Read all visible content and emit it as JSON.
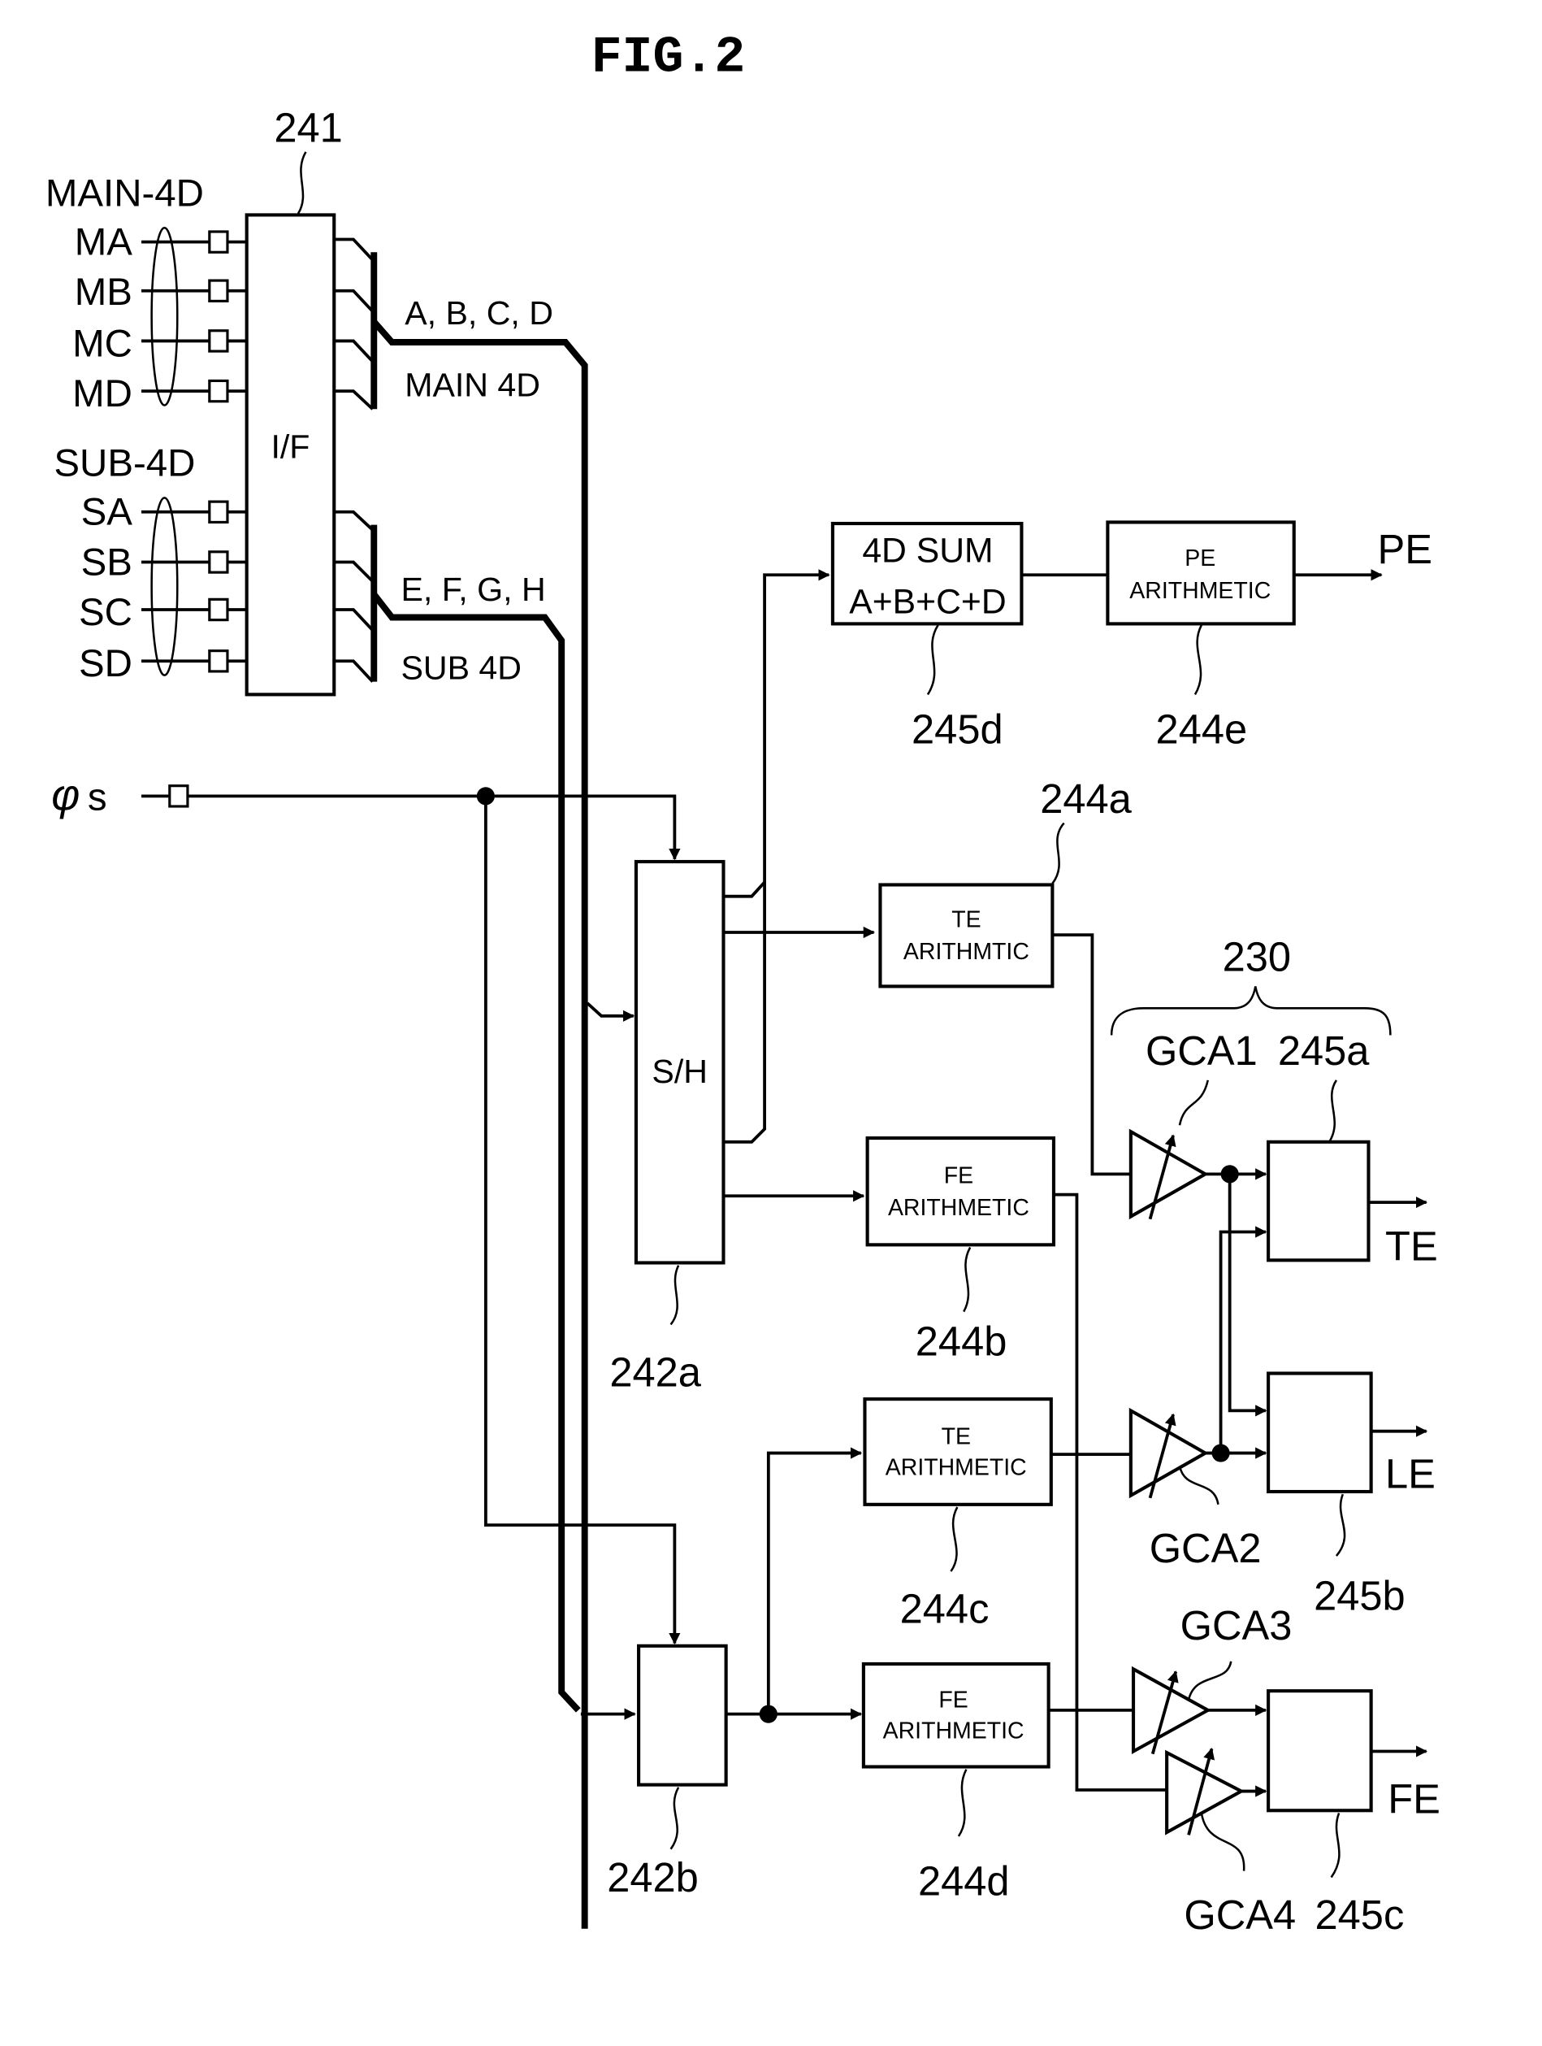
{
  "figure": {
    "title": "FIG.2"
  },
  "interface": {
    "ref": "241",
    "label": "I/F",
    "main_group_label": "MAIN-4D",
    "sub_group_label": "SUB-4D",
    "main_inputs": [
      "MA",
      "MB",
      "MC",
      "MD"
    ],
    "sub_inputs": [
      "SA",
      "SB",
      "SC",
      "SD"
    ],
    "main_bus_signals": "A, B, C, D",
    "main_bus_label": "MAIN 4D",
    "sub_bus_signals": "E, F, G, H",
    "sub_bus_label": "SUB 4D"
  },
  "clock": {
    "label_symbol": "φ",
    "label_sub": "s"
  },
  "sample_hold": {
    "main": {
      "ref": "242a",
      "label": "S/H"
    },
    "sub": {
      "ref": "242b",
      "label": ""
    }
  },
  "sum_block": {
    "ref": "245d",
    "line1": "4D  SUM",
    "line2": "A+B+C+D"
  },
  "pe_block": {
    "ref": "244e",
    "line1": "PE",
    "line2": "ARITHMETIC",
    "output": "PE"
  },
  "arith_blocks": [
    {
      "ref": "244a",
      "line1": "TE",
      "line2": "ARITHMTIC"
    },
    {
      "ref": "244b",
      "line1": "FE",
      "line2": "ARITHMETIC"
    },
    {
      "ref": "244c",
      "line1": "TE",
      "line2": "ARITHMETIC"
    },
    {
      "ref": "244d",
      "line1": "FE",
      "line2": "ARITHMETIC"
    }
  ],
  "gain_group": {
    "ref": "230"
  },
  "amplifiers": [
    "GCA1",
    "GCA2",
    "GCA3",
    "GCA4"
  ],
  "output_blocks": [
    {
      "ref": "245a",
      "output": "TE"
    },
    {
      "ref": "245b",
      "output": "LE"
    },
    {
      "ref": "245c",
      "output": "FE"
    }
  ]
}
